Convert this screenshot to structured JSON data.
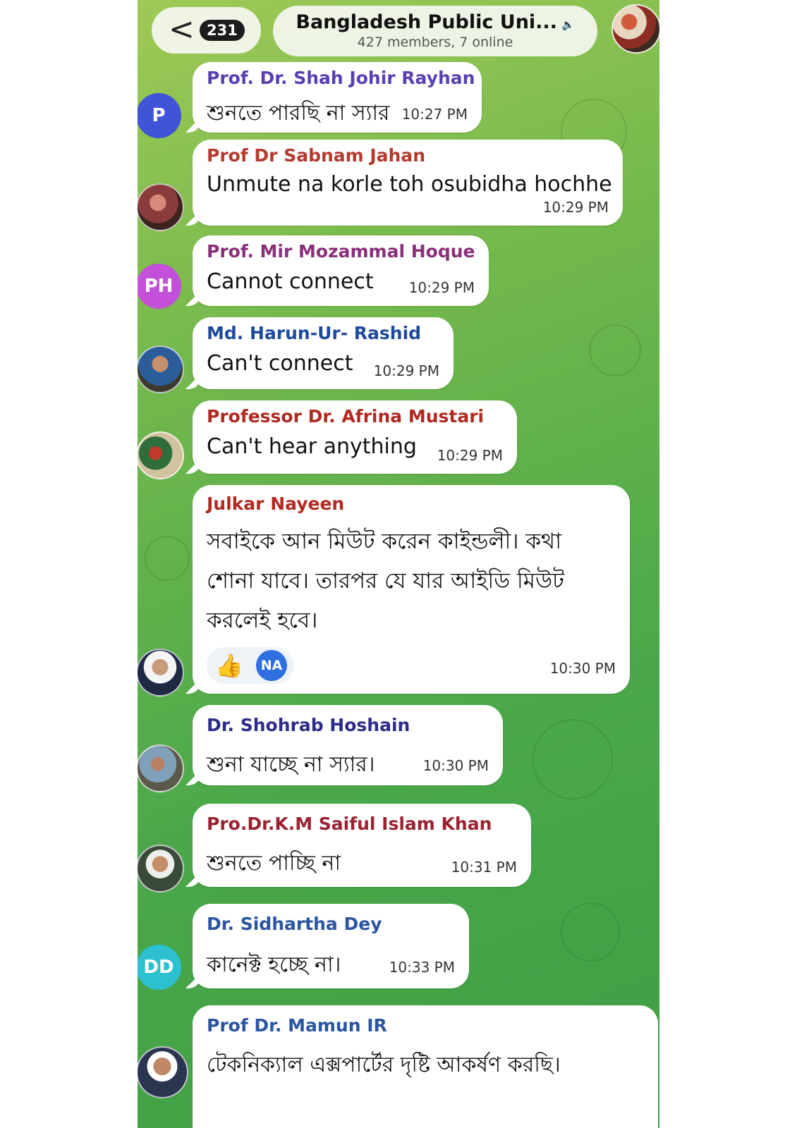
{
  "header": {
    "back_chevron": "<",
    "unread_count": "231",
    "title": "Bangladesh Public Uni...",
    "mute_icon": "🔈",
    "subtitle": "427 members, 7 online"
  },
  "colors": {
    "wallpaper": "#4aa84a",
    "bubble": "#ffffff",
    "badge": "#1c1c1c"
  },
  "messages": [
    {
      "sender": "Prof. Dr. Shah Johir Rayhan",
      "sender_color": "#5a3fb0",
      "avatar": {
        "type": "initials",
        "text": "P",
        "color": "#3f54d6"
      },
      "text": "শুনতে পারছি না স্যার",
      "time": "10:27 PM"
    },
    {
      "sender": "Prof Dr Sabnam Jahan",
      "sender_color": "#b43a2e",
      "avatar": {
        "type": "photo",
        "icon": "user-photo-icon"
      },
      "text": "Unmute na korle toh osubidha hochhe",
      "time": "10:29 PM"
    },
    {
      "sender": "Prof. Mir Mozammal Hoque",
      "sender_color": "#8a2f7a",
      "avatar": {
        "type": "initials",
        "text": "PH",
        "color": "#c44fd8"
      },
      "text": "Cannot connect",
      "time": "10:29 PM"
    },
    {
      "sender": "Md. Harun-Ur- Rashid",
      "sender_color": "#1f4a9c",
      "avatar": {
        "type": "photo",
        "icon": "user-photo-icon"
      },
      "text": "Can't connect",
      "time": "10:29 PM"
    },
    {
      "sender": "Professor Dr. Afrina Mustari",
      "sender_color": "#b02a20",
      "avatar": {
        "type": "photo",
        "icon": "user-photo-icon"
      },
      "text": "Can't hear anything",
      "time": "10:29 PM"
    },
    {
      "sender": "Julkar Nayeen",
      "sender_color": "#b02a20",
      "avatar": {
        "type": "photo",
        "icon": "user-photo-icon"
      },
      "text": "সবাইকে আন মিউট করেন কাইন্ডলী। কথা শোনা যাবে। তারপর যে যার আইডি মিউট করলেই হবে।",
      "time": "10:30 PM",
      "reactions": {
        "emoji": "👍",
        "reactor_initials": "NA"
      }
    },
    {
      "sender": "Dr. Shohrab Hoshain",
      "sender_color": "#2c2c8a",
      "avatar": {
        "type": "photo",
        "icon": "user-photo-icon"
      },
      "text": "শুনা যাচ্ছে না স্যার।",
      "time": "10:30 PM"
    },
    {
      "sender": "Pro.Dr.K.M Saiful Islam Khan",
      "sender_color": "#9a2230",
      "avatar": {
        "type": "photo",
        "icon": "user-photo-icon"
      },
      "text": "শুনতে পাচ্ছি না",
      "time": "10:31 PM"
    },
    {
      "sender": "Dr. Sidhartha Dey",
      "sender_color": "#2a55a0",
      "avatar": {
        "type": "initials",
        "text": "DD",
        "color": "#2cc0d0"
      },
      "text": "কানেক্ট হচ্ছে না।",
      "time": "10:33 PM"
    },
    {
      "sender": "Prof Dr. Mamun IR",
      "sender_color": "#2a55a0",
      "avatar": {
        "type": "photo",
        "icon": "user-photo-icon"
      },
      "text": "টেকনিক্যাল এক্সপার্টের দৃষ্টি আকর্ষণ করছি।",
      "time": ""
    }
  ]
}
